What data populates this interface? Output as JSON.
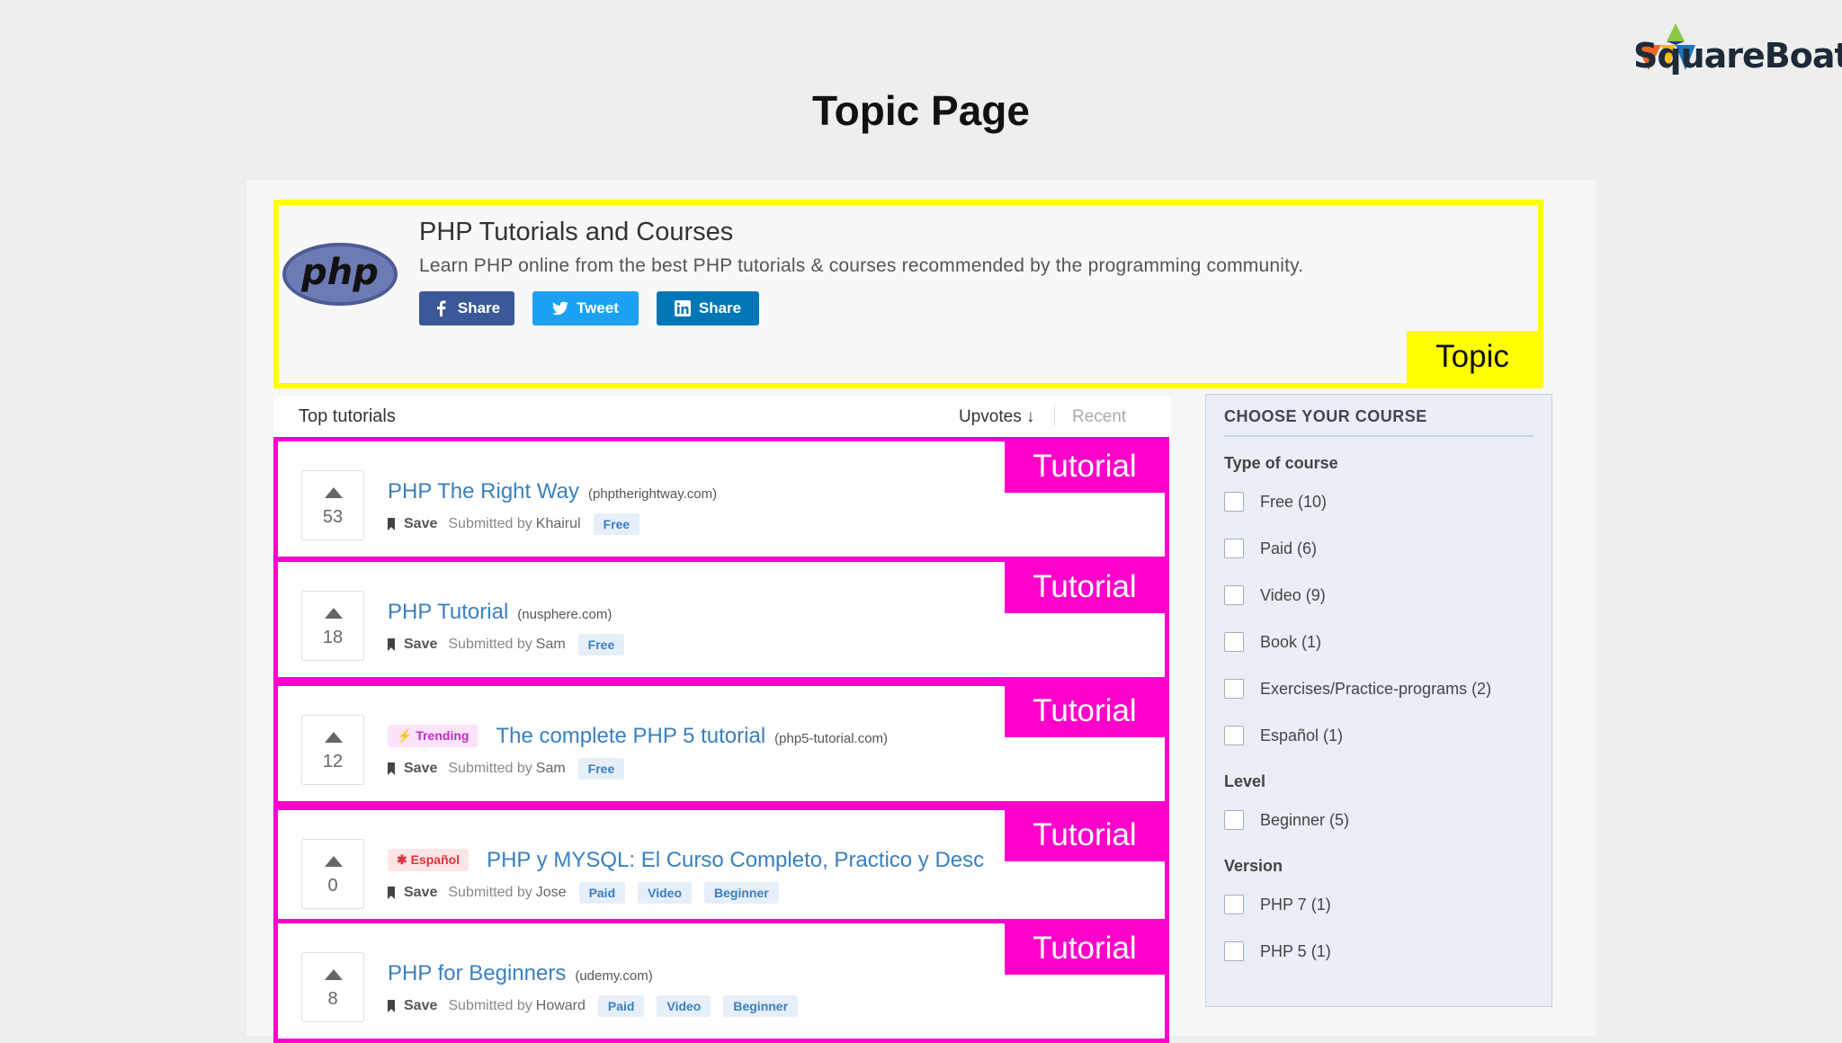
{
  "slide": {
    "title": "Topic Page",
    "brand": "SquareBoat"
  },
  "topic": {
    "title": "PHP Tutorials and Courses",
    "description": "Learn PHP online from the best PHP tutorials & courses recommended by the programming community.",
    "logo_text": "php",
    "share_buttons": [
      {
        "label": "Share",
        "icon": "facebook-icon",
        "color": "#3b5998"
      },
      {
        "label": "Tweet",
        "icon": "twitter-icon",
        "color": "#1da1f2"
      },
      {
        "label": "Share",
        "icon": "linkedin-icon",
        "color": "#0077b5"
      }
    ],
    "annotation": "Topic"
  },
  "list": {
    "heading": "Top tutorials",
    "sort_upvotes": "Upvotes",
    "sort_recent": "Recent",
    "annotation": "Tutorial"
  },
  "tutorials": [
    {
      "votes": "53",
      "badge": "",
      "title": "PHP The Right Way",
      "domain": "(phptherightway.com)",
      "save": "Save",
      "submitted": "Submitted by",
      "author": "Khairul",
      "tags": [
        "Free"
      ]
    },
    {
      "votes": "18",
      "badge": "",
      "title": "PHP Tutorial",
      "domain": "(nusphere.com)",
      "save": "Save",
      "submitted": "Submitted by",
      "author": "Sam",
      "tags": [
        "Free"
      ]
    },
    {
      "votes": "12",
      "badge": "Trending",
      "title": "The complete PHP 5 tutorial",
      "domain": "(php5-tutorial.com)",
      "save": "Save",
      "submitted": "Submitted by",
      "author": "Sam",
      "tags": [
        "Free"
      ]
    },
    {
      "votes": "0",
      "badge": "Español",
      "title": "PHP y MYSQL: El Curso Completo, Practico y Desc",
      "domain": "",
      "save": "Save",
      "submitted": "Submitted by",
      "author": "Jose",
      "tags": [
        "Paid",
        "Video",
        "Beginner"
      ]
    },
    {
      "votes": "8",
      "badge": "",
      "title": "PHP for Beginners",
      "domain": "(udemy.com)",
      "save": "Save",
      "submitted": "Submitted by",
      "author": "Howard",
      "tags": [
        "Paid",
        "Video",
        "Beginner"
      ]
    }
  ],
  "sidebar": {
    "title": "CHOOSE YOUR COURSE",
    "groups": [
      {
        "label": "Type of course",
        "items": [
          "Free (10)",
          "Paid (6)",
          "Video (9)",
          "Book (1)",
          "Exercises/Practice-programs (2)",
          "Español (1)"
        ]
      },
      {
        "label": "Level",
        "items": [
          "Beginner (5)"
        ]
      },
      {
        "label": "Version",
        "items": [
          "PHP 7 (1)",
          "PHP 5 (1)"
        ]
      }
    ]
  },
  "colors": {
    "topic_highlight": "#ffff00",
    "tutorial_highlight": "#ff00cc",
    "link": "#3a7fc0"
  }
}
